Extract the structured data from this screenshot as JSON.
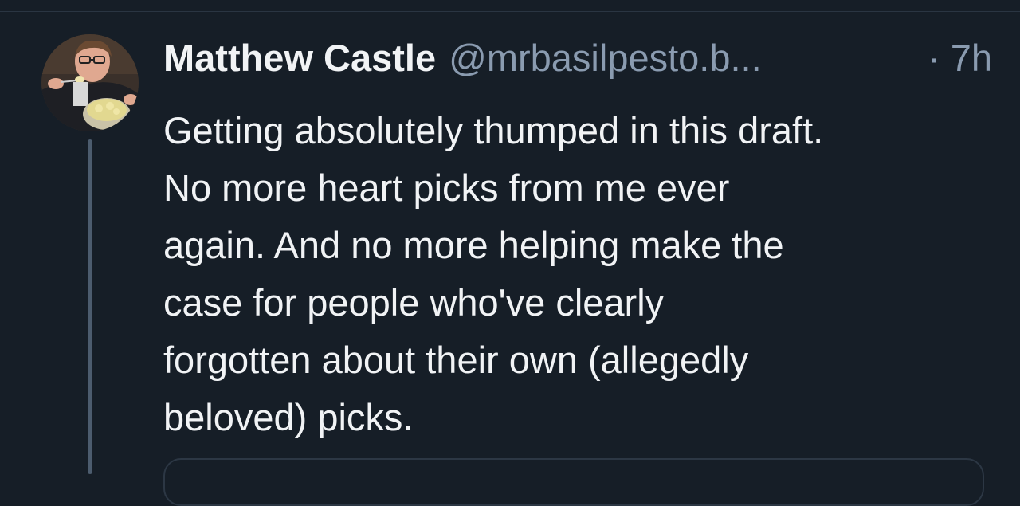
{
  "post": {
    "author_name": "Matthew Castle",
    "author_handle": "@mrbasilpesto.b...",
    "timestamp": "· 7h",
    "text_lines": [
      "Getting absolutely thumped in this draft.",
      "No more heart picks from me ever",
      "again. And no more helping make the",
      "case for people who've clearly",
      "forgotten about their own (allegedly",
      "beloved) picks."
    ]
  },
  "colors": {
    "background": "#161e27",
    "primary_text": "#f1f3f5",
    "secondary_text": "#8a9bb0",
    "thread_line": "#4c5c6e"
  }
}
